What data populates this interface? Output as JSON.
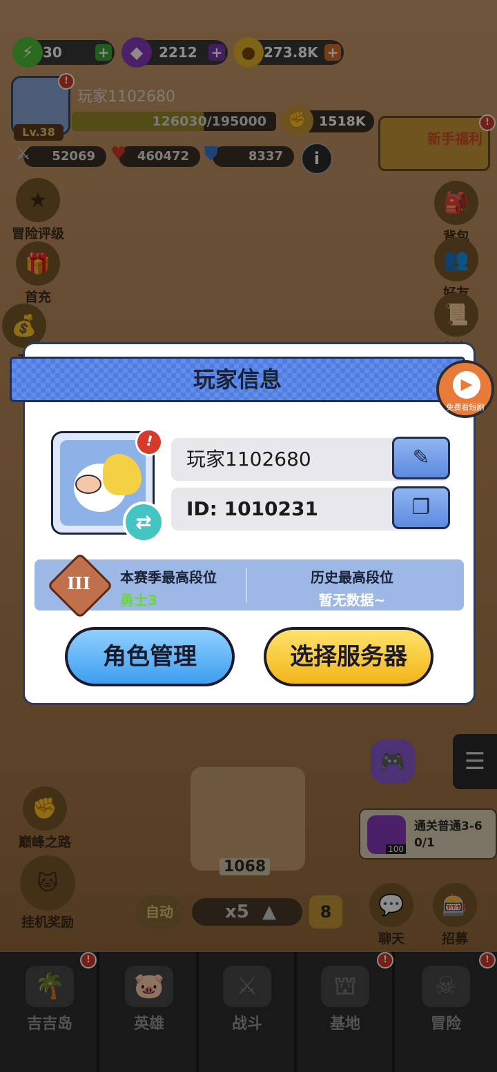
{
  "resources": [
    {
      "id": "energy",
      "value": "30",
      "icon": "lightning-icon",
      "color": "#4fc23a"
    },
    {
      "id": "gems",
      "value": "2212",
      "icon": "gem-icon",
      "color": "#8a3abf"
    },
    {
      "id": "gold",
      "value": "273.8K",
      "icon": "coin-icon",
      "color": "#e8b52a"
    }
  ],
  "player": {
    "name": "玩家1102680",
    "level": "Lv.38",
    "exp": "126030/195000",
    "exp_fraction": 0.646,
    "power": "1518K",
    "attack": "52069",
    "hp": "460472",
    "defense": "8337",
    "info_label": "i"
  },
  "side_left": [
    "冒险评级",
    "首充",
    "充",
    "巅峰之路",
    "挂机奖励"
  ],
  "side_right": [
    "背包",
    "好友",
    "任务",
    "聊天",
    "招募"
  ],
  "newbie_label": "新手福利",
  "modal": {
    "title": "玩家信息",
    "name_value": "玩家1102680",
    "id_value": "ID: 1010231",
    "season_label": "本赛季最高段位",
    "season_value": "勇士3",
    "history_label": "历史最高段位",
    "history_value": "暂无数据~",
    "rank_numeral": "III",
    "role_button": "角色管理",
    "server_button": "选择服务器",
    "edit_icon": "✎",
    "copy_icon": "❐",
    "swap_icon": "⇄",
    "alert_icon": "!"
  },
  "video_caption": "免费看短剧",
  "hud": {
    "chest_count": "1068",
    "auto_label": "自动",
    "speed_label": "x5",
    "speed_arrow": "▲",
    "level_badge": "8",
    "task_text": "通关普通3-6",
    "task_progress": "0/1",
    "gem_count": "100"
  },
  "nav": [
    "吉吉岛",
    "英雄",
    "战斗",
    "基地",
    "冒险"
  ],
  "colors": {
    "accent_blue": "#4f7de3",
    "season_value": "#6ed63a",
    "button_blue": "#3e9ef0",
    "button_yellow": "#f2b51a"
  }
}
